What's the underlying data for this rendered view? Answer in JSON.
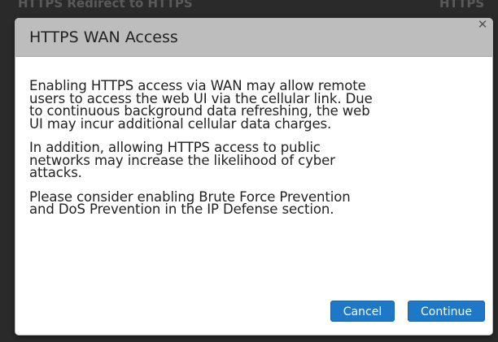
{
  "background": {
    "header_left": "HTTPS Redirect to HTTPS",
    "header_right": "HTTPS"
  },
  "dialog": {
    "title": "HTTPS WAN Access",
    "close_icon": "close-x",
    "paragraphs": [
      {
        "lines": [
          "Enabling HTTPS access via WAN may allow remote",
          "users to access the web UI via the cellular link. Due",
          "to continuous background data refreshing, the web",
          "UI may incur additional cellular data charges."
        ]
      },
      {
        "lines": [
          "In addition, allowing HTTPS access to public",
          "networks may increase the likelihood of cyber",
          "attacks."
        ]
      },
      {
        "lines": [
          "Please consider enabling Brute Force Prevention",
          "and DoS Prevention in the IP Defense section."
        ]
      }
    ],
    "buttons": {
      "cancel": "Cancel",
      "continue": "Continue"
    },
    "colors": {
      "titlebar": "#bdbdbd",
      "button": "#1d78c8",
      "text": "#222222"
    }
  }
}
